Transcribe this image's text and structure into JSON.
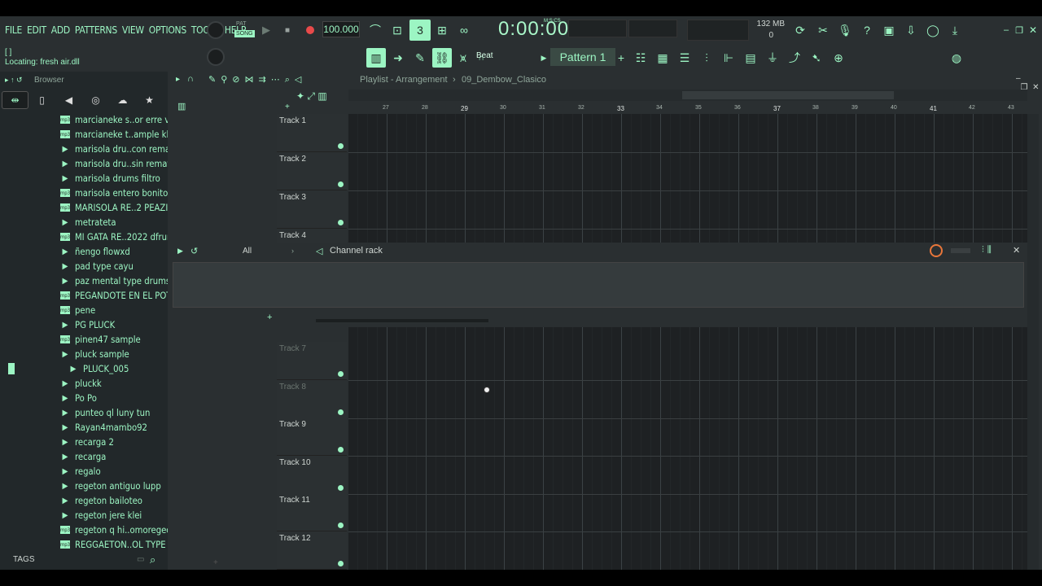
{
  "menu": [
    "FILE",
    "EDIT",
    "ADD",
    "PATTERNS",
    "VIEW",
    "OPTIONS",
    "TOOLS",
    "HELP"
  ],
  "hint_top": "[ ]",
  "hint": "Locating: fresh air.dll",
  "transport": {
    "pat": "PAT",
    "song": "SONG",
    "tempo": "100.000",
    "time": "0:00:00",
    "time_label": "M:S:CS",
    "memory": "132 MB",
    "poly": "0"
  },
  "pattern": {
    "beat": "Beat",
    "name": "Pattern 1"
  },
  "browser": {
    "title": "Browser",
    "tags": "TAGS",
    "items": [
      {
        "name": "marcianeke s..or erre vox",
        "type": "audio"
      },
      {
        "name": "marcianeke t..ample kl xd",
        "type": "audio"
      },
      {
        "name": "marisola dru..con remate",
        "type": "folder"
      },
      {
        "name": "marisola dru..sin remate",
        "type": "folder"
      },
      {
        "name": "marisola drums filtro",
        "type": "folder"
      },
      {
        "name": "marisola entero bonito",
        "type": "audio"
      },
      {
        "name": "MARISOLA RE..2 PEAZITO",
        "type": "audio"
      },
      {
        "name": "metrateta",
        "type": "folder"
      },
      {
        "name": "MI GATA RE..2022 dfrum",
        "type": "audio"
      },
      {
        "name": "ñengo flowxd",
        "type": "folder"
      },
      {
        "name": "pad type cayu",
        "type": "folder"
      },
      {
        "name": "paz mental type drums",
        "type": "folder"
      },
      {
        "name": "PEGANDOTE EN EL POTO",
        "type": "audio"
      },
      {
        "name": "pene",
        "type": "audio"
      },
      {
        "name": "PG PLUCK",
        "type": "folder"
      },
      {
        "name": "pinen47 sample",
        "type": "audio"
      },
      {
        "name": "pluck sample",
        "type": "folder"
      },
      {
        "name": "PLUCK_005",
        "type": "folder",
        "sub": true
      },
      {
        "name": "pluckk",
        "type": "folder"
      },
      {
        "name": "Po Po",
        "type": "folder"
      },
      {
        "name": "punteo ql luny tun",
        "type": "folder"
      },
      {
        "name": "Rayan4mambo92",
        "type": "folder"
      },
      {
        "name": "recarga 2",
        "type": "folder"
      },
      {
        "name": "recarga",
        "type": "folder"
      },
      {
        "name": "regalo",
        "type": "folder"
      },
      {
        "name": "regeton antiguo lupp",
        "type": "folder"
      },
      {
        "name": "regeton bailoteo",
        "type": "folder"
      },
      {
        "name": "regeton jere klei",
        "type": "folder"
      },
      {
        "name": "regeton q hi..omoregeotn",
        "type": "audio"
      },
      {
        "name": "REGGAETON..OL TYPE 22",
        "type": "audio"
      }
    ]
  },
  "playlist": {
    "title": "Playlist - Arrangement",
    "project": "09_Dembow_Clasico",
    "bars": [
      "27",
      "28",
      "29",
      "30",
      "31",
      "32",
      "33",
      "34",
      "35",
      "36",
      "37",
      "38",
      "39",
      "40",
      "41",
      "42",
      "43"
    ],
    "tracks_top": [
      "Track 1",
      "Track 2",
      "Track 3",
      "Track 4"
    ],
    "tracks_bottom": [
      "Track 7",
      "Track 8",
      "Track 9",
      "Track 10",
      "Track 11",
      "Track 12"
    ]
  },
  "channel_rack": {
    "title": "Channel rack",
    "filter": "All"
  },
  "colors": {
    "accent": "#9cf5c3",
    "bg": "#2a2f31"
  }
}
